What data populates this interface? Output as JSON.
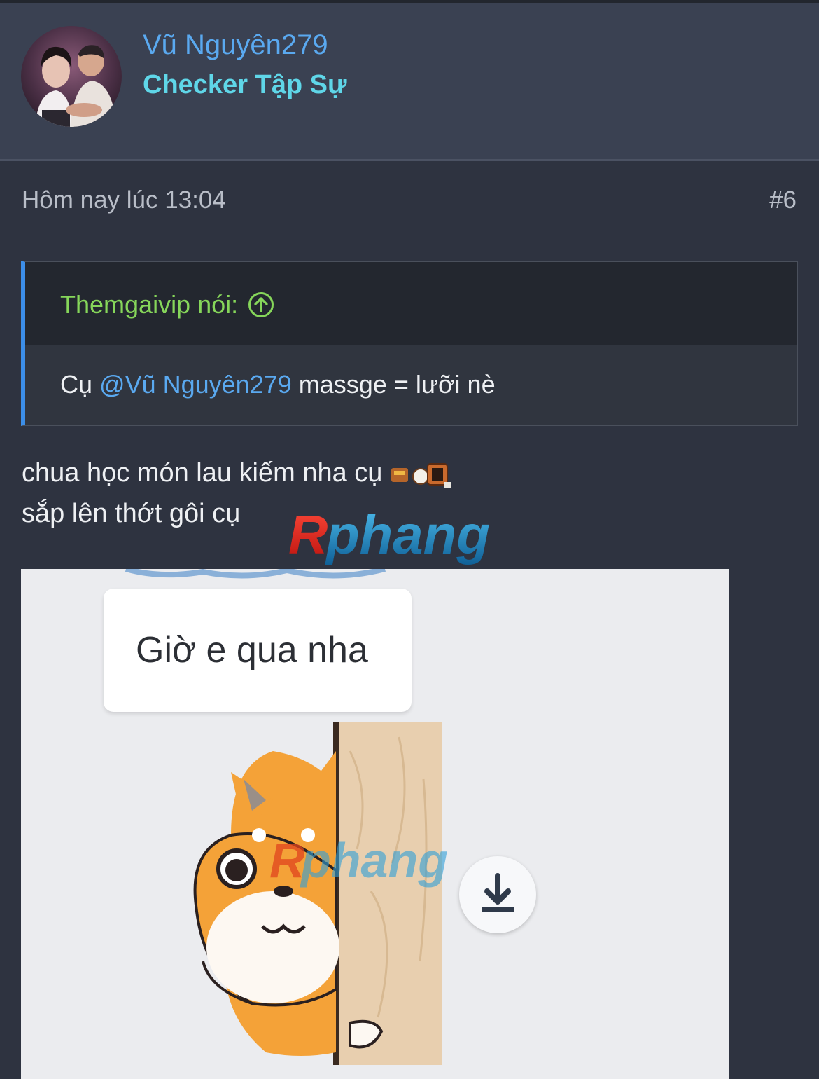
{
  "user": {
    "name": "Vũ Nguyên279",
    "title": "Checker Tập Sự"
  },
  "post": {
    "time": "Hôm nay lúc 13:04",
    "number": "#6"
  },
  "quote": {
    "author_label": "Themgaivip nói:",
    "prefix": "Cụ ",
    "mention": "@Vũ Nguyên279",
    "suffix": " massge = lưỡi nè"
  },
  "message": {
    "line1": "chua học món lau kiếm nha cụ",
    "line2": "sắp lên thớt gôi cụ"
  },
  "image": {
    "bubble_text": "Giờ e qua nha"
  },
  "watermark": "Rphang",
  "colors": {
    "background": "#2e3340",
    "header": "#3a4152",
    "link": "#5aa9f0",
    "user_title": "#5fd6e8",
    "quote_author": "#86d65a",
    "quote_border": "#3c8ee8"
  }
}
